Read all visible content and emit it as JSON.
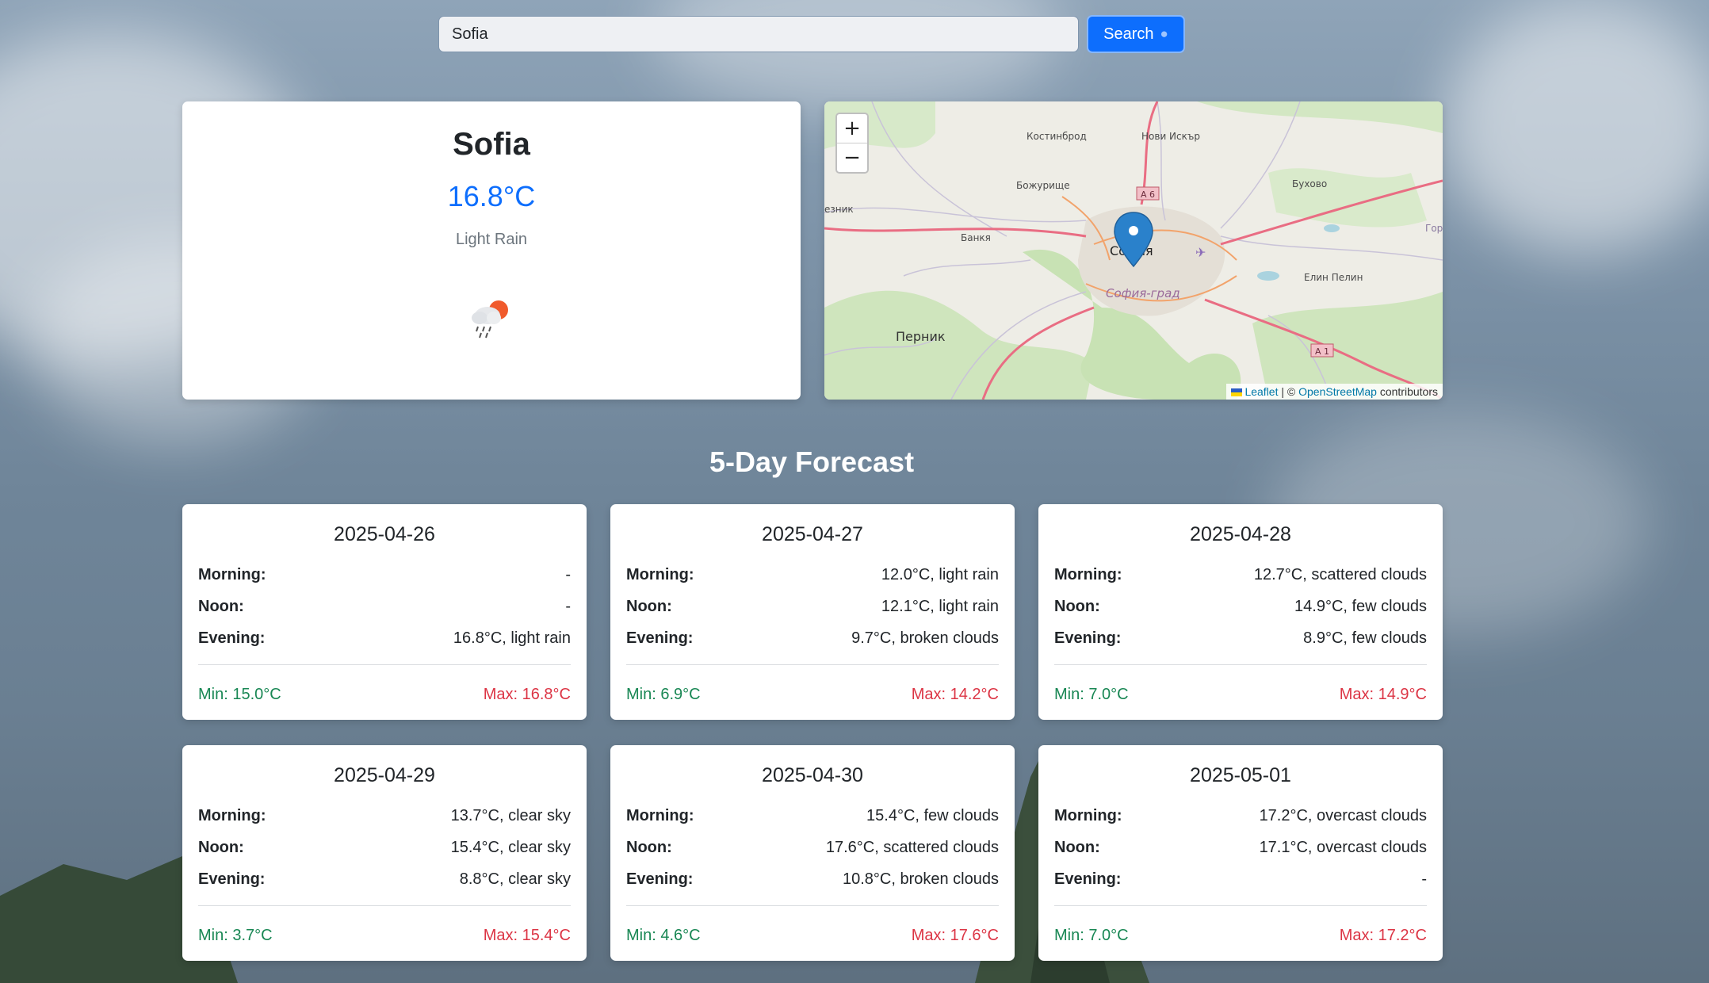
{
  "search": {
    "value": "Sofia",
    "button_label": "Search"
  },
  "current": {
    "city": "Sofia",
    "temperature": "16.8°C",
    "description": "Light Rain",
    "icon": "rain-cloud-sun-icon"
  },
  "map": {
    "zoom_in": "+",
    "zoom_out": "−",
    "labels": {
      "kostinbrod": "Костинброд",
      "novi_iskar": "Нови Искър",
      "bozhurishte": "Божурище",
      "bankya": "Банкя",
      "sofia": "София",
      "sofia_grad": "София-град",
      "buhovo": "Бухово",
      "elin_pelin": "Елин Пелин",
      "pernik": "Перник",
      "a6": "A 6",
      "a1": "A 1",
      "edge_left": "езник",
      "edge_right": "Гор"
    },
    "attribution": {
      "leaflet": "Leaflet",
      "separator": "| ©",
      "osm": "OpenStreetMap",
      "suffix": "contributors"
    },
    "marker": "map-marker-icon"
  },
  "forecast": {
    "title": "5-Day Forecast",
    "labels": {
      "morning": "Morning:",
      "noon": "Noon:",
      "evening": "Evening:"
    },
    "days": [
      {
        "date": "2025-04-26",
        "morning": "-",
        "noon": "-",
        "evening": "16.8°C, light rain",
        "min": "Min: 15.0°C",
        "max": "Max: 16.8°C"
      },
      {
        "date": "2025-04-27",
        "morning": "12.0°C, light rain",
        "noon": "12.1°C, light rain",
        "evening": "9.7°C, broken clouds",
        "min": "Min: 6.9°C",
        "max": "Max: 14.2°C"
      },
      {
        "date": "2025-04-28",
        "morning": "12.7°C, scattered clouds",
        "noon": "14.9°C, few clouds",
        "evening": "8.9°C, few clouds",
        "min": "Min: 7.0°C",
        "max": "Max: 14.9°C"
      },
      {
        "date": "2025-04-29",
        "morning": "13.7°C, clear sky",
        "noon": "15.4°C, clear sky",
        "evening": "8.8°C, clear sky",
        "min": "Min: 3.7°C",
        "max": "Max: 15.4°C"
      },
      {
        "date": "2025-04-30",
        "morning": "15.4°C, few clouds",
        "noon": "17.6°C, scattered clouds",
        "evening": "10.8°C, broken clouds",
        "min": "Min: 4.6°C",
        "max": "Max: 17.6°C"
      },
      {
        "date": "2025-05-01",
        "morning": "17.2°C, overcast clouds",
        "noon": "17.1°C, overcast clouds",
        "evening": "-",
        "min": "Min: 7.0°C",
        "max": "Max: 17.2°C"
      }
    ]
  },
  "colors": {
    "primary": "#0d6efd",
    "min": "#198754",
    "max": "#dc3545",
    "muted": "#6c757d"
  }
}
